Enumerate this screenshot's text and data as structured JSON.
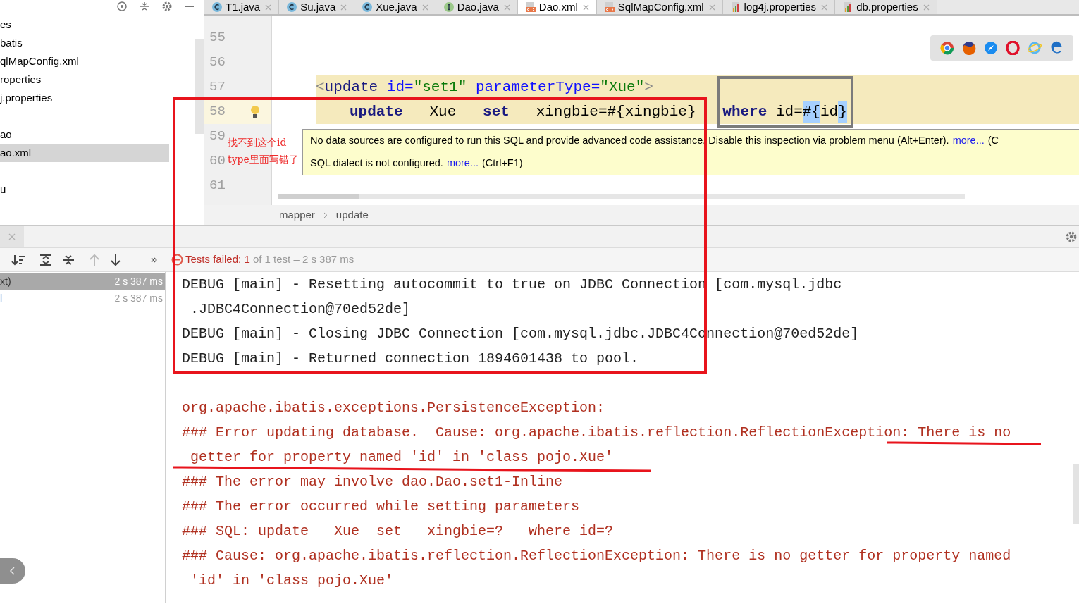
{
  "project_tree": {
    "groups": [
      [
        {
          "label": "es",
          "selected": false
        },
        {
          "label": "batis",
          "selected": false
        },
        {
          "label": "qlMapConfig.xml",
          "selected": false
        },
        {
          "label": "roperties",
          "selected": false
        },
        {
          "label": "j.properties",
          "selected": false
        }
      ],
      [
        {
          "label": "ao",
          "selected": false
        },
        {
          "label": "ao.xml",
          "selected": true
        }
      ],
      [
        {
          "label": "u",
          "selected": false
        }
      ]
    ]
  },
  "editor": {
    "tabs": [
      {
        "label": "T1.java",
        "kind": "class",
        "selected": false
      },
      {
        "label": "Su.java",
        "kind": "class",
        "selected": false
      },
      {
        "label": "Xue.java",
        "kind": "class",
        "selected": false
      },
      {
        "label": "Dao.java",
        "kind": "interface",
        "selected": false
      },
      {
        "label": "Dao.xml",
        "kind": "xml",
        "selected": true
      },
      {
        "label": "SqlMapConfig.xml",
        "kind": "xml",
        "selected": false
      },
      {
        "label": "log4j.properties",
        "kind": "properties",
        "selected": false
      },
      {
        "label": "db.properties",
        "kind": "properties",
        "selected": false
      }
    ],
    "lines": [
      {
        "number": "55"
      },
      {
        "number": "56"
      },
      {
        "number": "57",
        "indented": false,
        "tokens": [
          {
            "kind": "punct",
            "text": "<"
          },
          {
            "kind": "tag",
            "text": "update"
          },
          {
            "kind": "attr",
            "text": " id="
          },
          {
            "kind": "value",
            "text": "\"set1\""
          },
          {
            "kind": "attr",
            "text": " parameterType="
          },
          {
            "kind": "value",
            "text": "\"Xue\""
          },
          {
            "kind": "punct",
            "text": ">"
          }
        ]
      },
      {
        "number": "58",
        "current": true,
        "indented": true,
        "tokens": [
          {
            "kind": "keyword",
            "text": "update"
          },
          {
            "kind": "plain",
            "text": "   Xue   "
          },
          {
            "kind": "keyword",
            "text": "set"
          },
          {
            "kind": "plain",
            "text": "   xingbie=#{xingbie}   "
          },
          {
            "kind": "keyword",
            "text": "where"
          },
          {
            "kind": "plain",
            "text": " id="
          },
          {
            "kind": "plain",
            "text": "#{",
            "highlight": true
          },
          {
            "kind": "plain",
            "text": "id"
          },
          {
            "kind": "plain",
            "text": "}",
            "highlight": true
          }
        ]
      },
      {
        "number": "59"
      },
      {
        "number": "60"
      },
      {
        "number": "61"
      }
    ],
    "tooltip": [
      {
        "text": "No data sources are configured to run this SQL and provide advanced code assistance. Disable this inspection via problem menu (Alt+Enter).",
        "link": "more...",
        "suffix": "(C"
      },
      {
        "text": "SQL dialect is not configured.",
        "link": "more...",
        "suffix": "(Ctrl+F1)"
      }
    ],
    "breadcrumb": [
      "mapper",
      "update"
    ]
  },
  "run_panel": {
    "status": {
      "label": "Tests failed:",
      "count": "1",
      "rest": "of 1 test – 2 s 387 ms"
    },
    "tests": [
      {
        "label": "xt)",
        "time": "2 s 387 ms",
        "selected": true
      },
      {
        "label": "l",
        "time": "2 s 387 ms",
        "selected": false
      }
    ],
    "console": [
      {
        "kind": "debug",
        "text": "DEBUG [main] - Resetting autocommit to true on JDBC Connection [com.mysql.jdbc"
      },
      {
        "kind": "debug",
        "text": " .JDBC4Connection@70ed52de]"
      },
      {
        "kind": "debug",
        "text": "DEBUG [main] - Closing JDBC Connection [com.mysql.jdbc.JDBC4Connection@70ed52de]"
      },
      {
        "kind": "debug",
        "text": "DEBUG [main] - Returned connection 1894601438 to pool."
      },
      {
        "kind": "blank"
      },
      {
        "kind": "error",
        "text": "org.apache.ibatis.exceptions.PersistenceException:"
      },
      {
        "kind": "error",
        "text": "### Error updating database.  Cause: org.apache.ibatis.reflection.ReflectionException: There is no"
      },
      {
        "kind": "error",
        "text": " getter for property named 'id' in 'class pojo.Xue'"
      },
      {
        "kind": "error",
        "text": "### The error may involve dao.Dao.set1-Inline"
      },
      {
        "kind": "error",
        "text": "### The error occurred while setting parameters"
      },
      {
        "kind": "error",
        "text": "### SQL: update   Xue  set   xingbie=?   where id=?"
      },
      {
        "kind": "error",
        "text": "### Cause: org.apache.ibatis.reflection.ReflectionException: There is no getter for property named"
      },
      {
        "kind": "error",
        "text": " 'id' in 'class pojo.Xue'"
      }
    ]
  },
  "annotation": {
    "note": [
      "找不到这个id",
      "type里面写错了"
    ]
  }
}
